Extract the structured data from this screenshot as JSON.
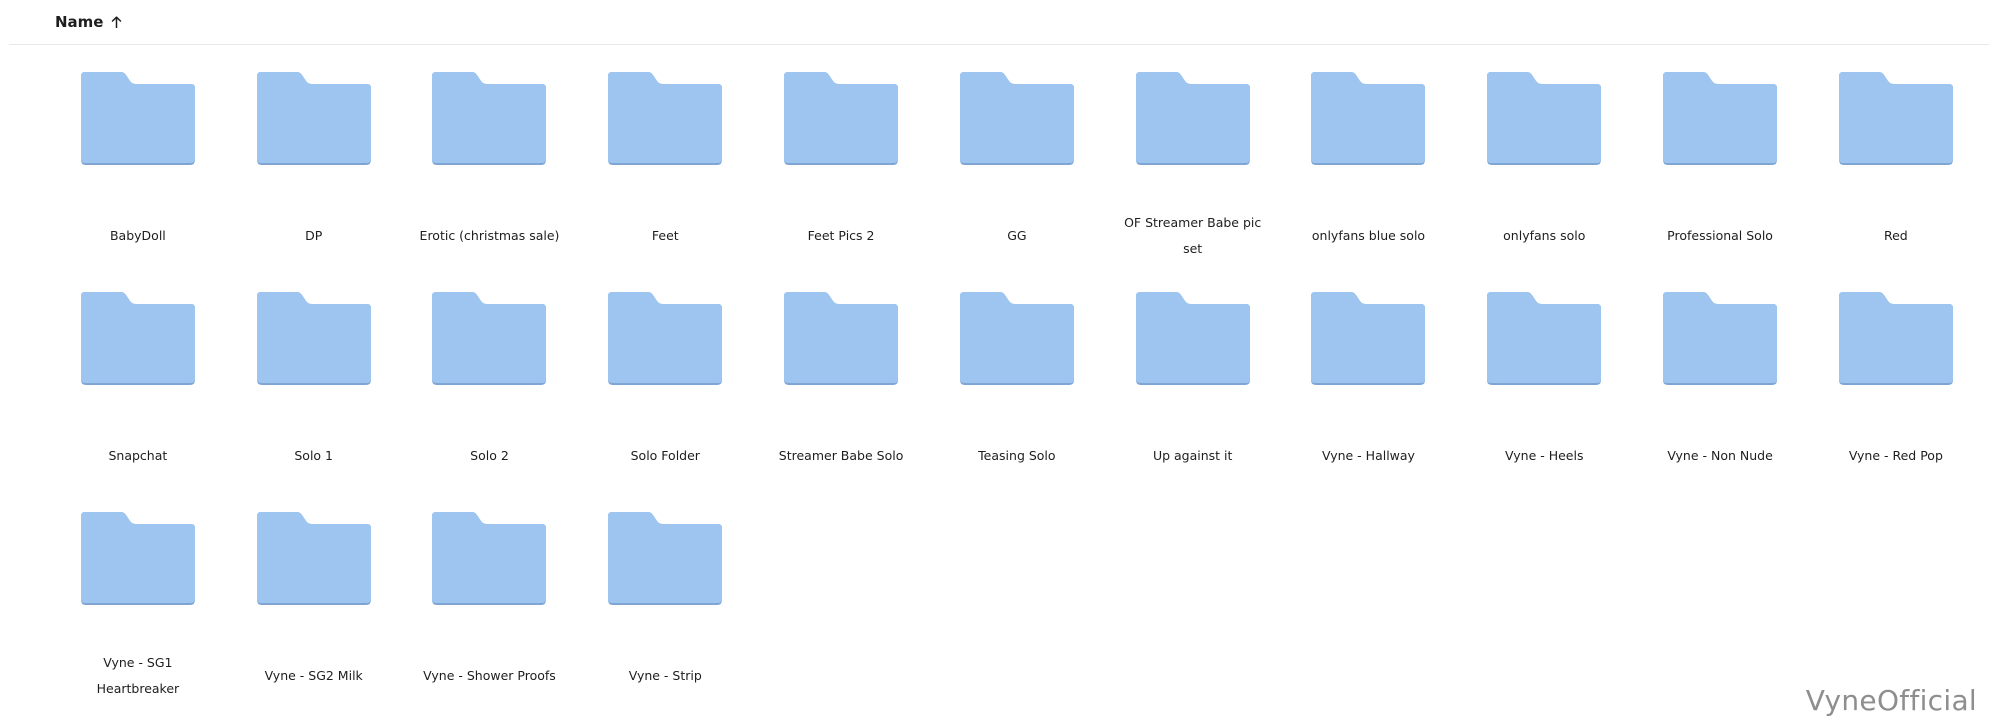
{
  "header": {
    "sort_label": "Name",
    "sort_direction": "ascending",
    "sort_icon": "arrow-up-icon"
  },
  "colors": {
    "folder_fill": "#9ec5ef",
    "folder_shadow": "#7fa6d3",
    "divider": "#e6e8eb",
    "watermark": "#8e8e8e"
  },
  "folders": [
    {
      "name": "BabyDoll"
    },
    {
      "name": "DP"
    },
    {
      "name": "Erotic (christmas sale)"
    },
    {
      "name": "Feet"
    },
    {
      "name": "Feet Pics 2"
    },
    {
      "name": "GG"
    },
    {
      "name": "OF Streamer Babe pic set"
    },
    {
      "name": "onlyfans blue solo"
    },
    {
      "name": "onlyfans solo"
    },
    {
      "name": "Professional Solo"
    },
    {
      "name": "Red"
    },
    {
      "name": "Snapchat"
    },
    {
      "name": "Solo 1"
    },
    {
      "name": "Solo 2"
    },
    {
      "name": "Solo Folder"
    },
    {
      "name": "Streamer Babe Solo"
    },
    {
      "name": "Teasing Solo"
    },
    {
      "name": "Up against it"
    },
    {
      "name": "Vyne - Hallway"
    },
    {
      "name": "Vyne - Heels"
    },
    {
      "name": "Vyne - Non Nude"
    },
    {
      "name": "Vyne - Red Pop"
    },
    {
      "name": "Vyne - SG1 Heartbreaker"
    },
    {
      "name": "Vyne - SG2 Milk"
    },
    {
      "name": "Vyne - Shower Proofs"
    },
    {
      "name": "Vyne - Strip"
    }
  ],
  "watermark": "VyneOfficial"
}
